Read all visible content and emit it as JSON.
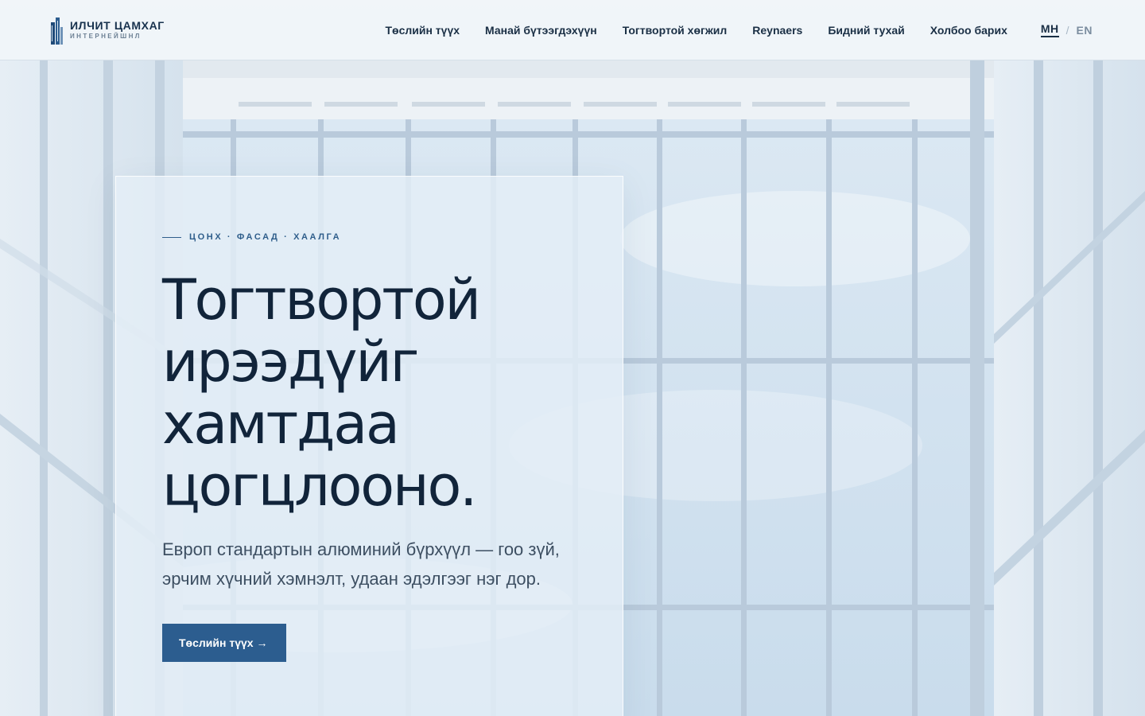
{
  "brand": {
    "name": "ИЛЧИТ ЦАМХАГ",
    "sub": "ИНТЕРНЕЙШНЛ",
    "icon": "building-logo-icon"
  },
  "nav": {
    "items": [
      {
        "label": "Төслийн түүх"
      },
      {
        "label": "Манай бүтээгдэхүүн"
      },
      {
        "label": "Тогтвортой хөгжил"
      },
      {
        "label": "Reynaers"
      },
      {
        "label": "Бидний тухай"
      },
      {
        "label": "Холбоо барих"
      }
    ],
    "lang_active": "MH",
    "lang_sep": "/",
    "lang_inactive": "EN"
  },
  "hero": {
    "eyebrow": "ЦОНХ · ФАСАД · ХААЛГА",
    "title_lines": [
      "Тогтвортой",
      "ирээдүйг",
      "хамтдаа",
      "цогцлооно."
    ],
    "description": "Европ стандартын алюминий бүрхүүл — гоо зүй, эрчим хүчний хэмнэлт, удаан эдэлгээг нэг дор.",
    "cta_label": "Төслийн түүх →"
  },
  "colors": {
    "accent": "#2c5d8f",
    "text_dark": "#11243a",
    "header_bg": "#f0f5f9"
  }
}
